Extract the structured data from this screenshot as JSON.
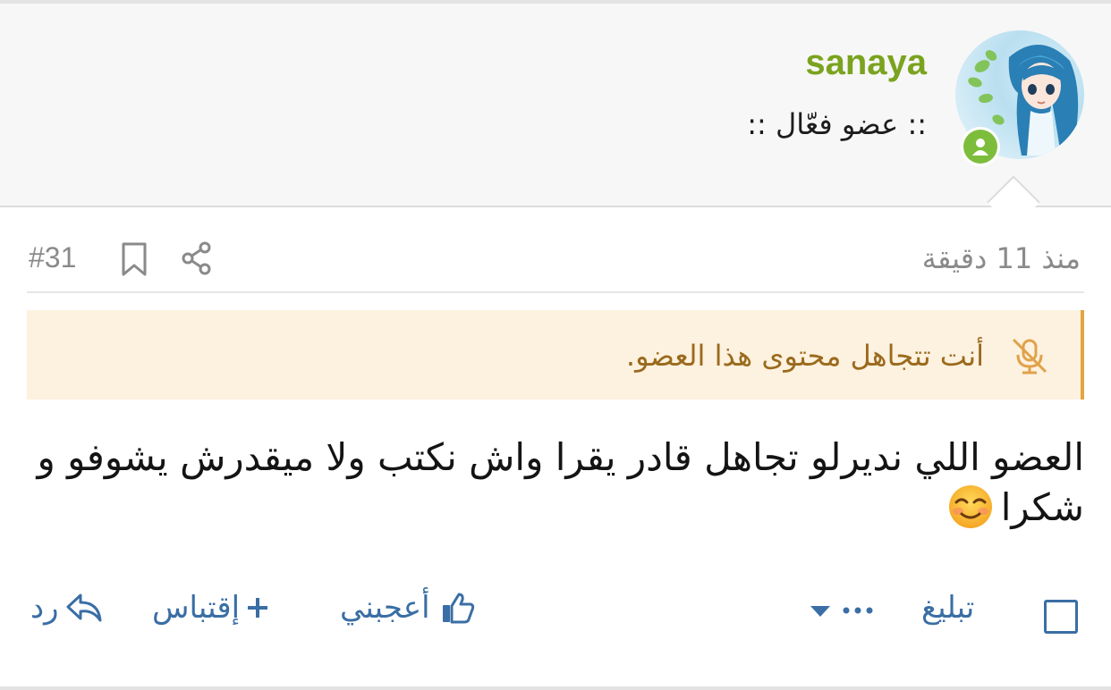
{
  "user": {
    "username": "sanaya",
    "title": ":: عضو فعّال ::",
    "avatar": "anime-girl-avatar",
    "status": "online-icon"
  },
  "post": {
    "time": "منذ 11 دقيقة",
    "number": "#31",
    "ignore_notice": "أنت تتجاهل محتوى هذا العضو.",
    "body": "العضو اللي نديرلو تجاهل قادر يقرا واش نكتب ولا ميقدرش يشوفو و شكرا",
    "emoji": "smiling-face-icon"
  },
  "actions": {
    "report": "تبليغ",
    "more": "•••",
    "like": "أعجبني",
    "quote": "إقتباس",
    "reply": "رد"
  },
  "colors": {
    "username": "#7aa31f",
    "link": "#3a6ea5",
    "notice_bg": "#fdf1df",
    "notice_border": "#e3a53f",
    "online": "#7dbd3c"
  }
}
